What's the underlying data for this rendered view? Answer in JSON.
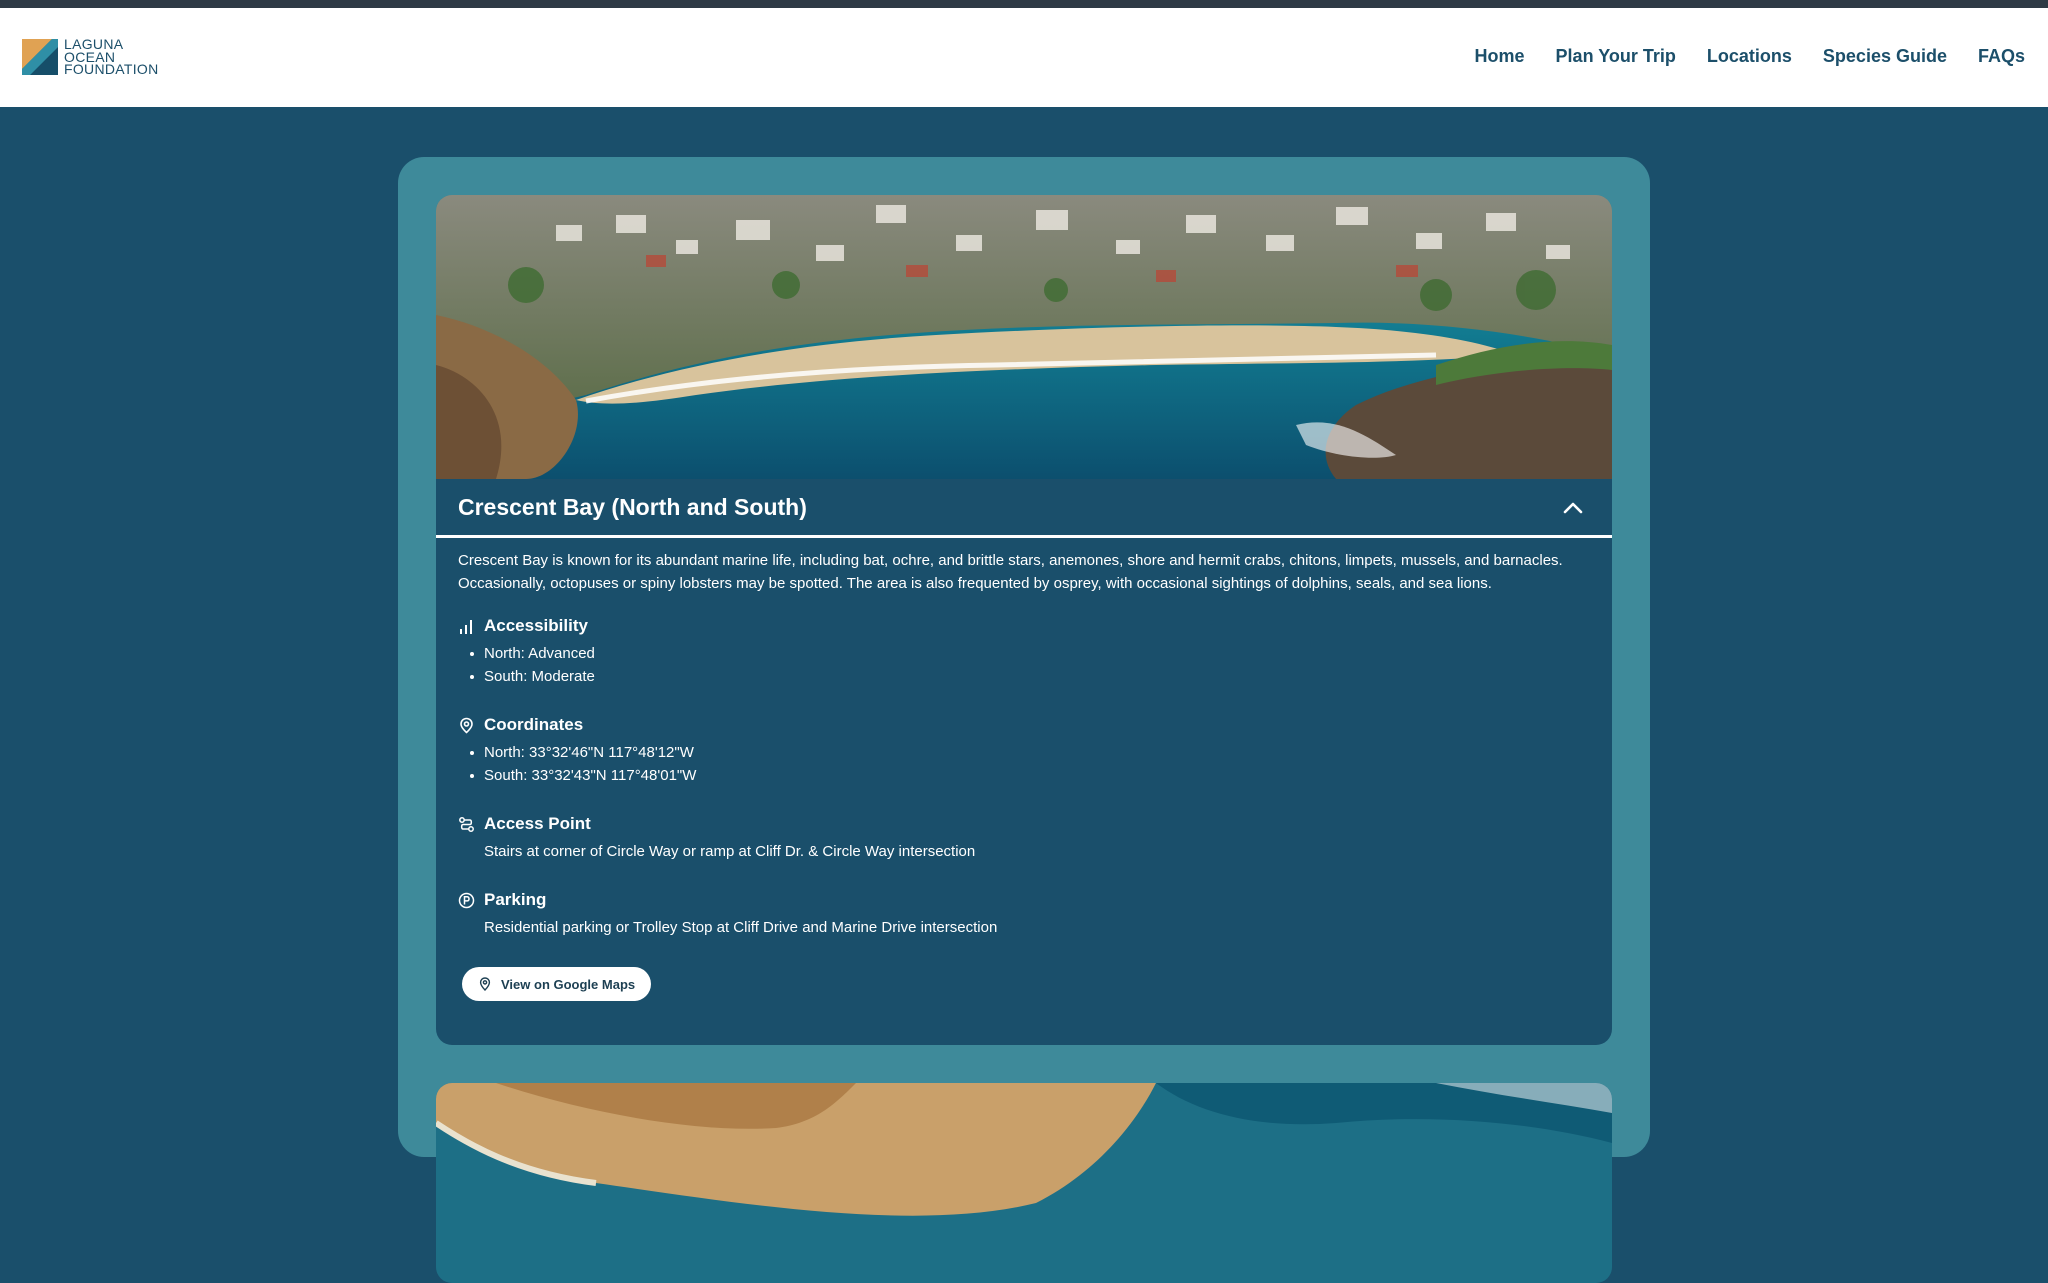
{
  "brand": {
    "name_lines": [
      "LAGUNA",
      "OCEAN",
      "FOUNDATION"
    ]
  },
  "nav": {
    "items": [
      "Home",
      "Plan Your Trip",
      "Locations",
      "Species Guide",
      "FAQs"
    ]
  },
  "location": {
    "title": "Crescent Bay (North and South)",
    "description": "Crescent Bay is known for its abundant marine life, including bat, ochre, and brittle stars, anemones, shore and hermit crabs, chitons, limpets, mussels, and barnacles. Occasionally, octopuses or spiny lobsters may be spotted. The area is also frequented by osprey, with occasional sightings of dolphins, seals, and sea lions.",
    "accessibility": {
      "title": "Accessibility",
      "icon": "signal-bars-icon",
      "items": [
        "North: Advanced",
        "South: Moderate"
      ]
    },
    "coordinates": {
      "title": "Coordinates",
      "icon": "map-pin-icon",
      "items": [
        "North: 33°32'46\"N 117°48'12\"W",
        "South: 33°32'43\"N 117°48'01\"W"
      ]
    },
    "access_point": {
      "title": "Access Point",
      "icon": "route-icon",
      "text": "Stairs at corner of Circle Way or ramp at Cliff Dr. & Circle Way intersection"
    },
    "parking": {
      "title": "Parking",
      "icon": "parking-icon",
      "text": "Residential parking or Trolley Stop at Cliff Drive and Marine Drive intersection"
    },
    "maps_button": "View on Google Maps"
  },
  "colors": {
    "page_bg": "#1a4f6b",
    "container_bg": "#3e8a9a",
    "header_bg": "#ffffff",
    "nav_text": "#1c4f6a",
    "top_strip": "#2e3a45"
  }
}
